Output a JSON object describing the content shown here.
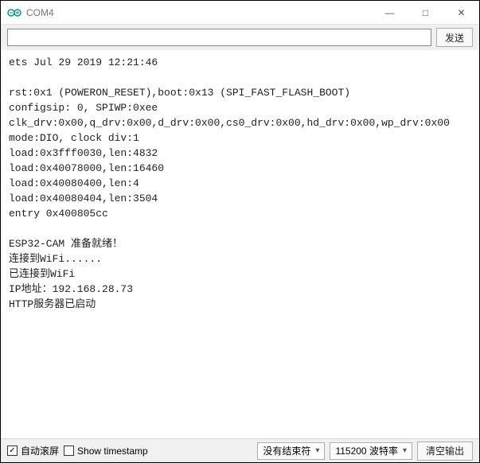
{
  "window": {
    "title": "COM4"
  },
  "toolbar": {
    "input_value": "",
    "input_placeholder": "",
    "send_label": "发送"
  },
  "console_text": "ets Jul 29 2019 12:21:46\n\nrst:0x1 (POWERON_RESET),boot:0x13 (SPI_FAST_FLASH_BOOT)\nconfigsip: 0, SPIWP:0xee\nclk_drv:0x00,q_drv:0x00,d_drv:0x00,cs0_drv:0x00,hd_drv:0x00,wp_drv:0x00\nmode:DIO, clock div:1\nload:0x3fff0030,len:4832\nload:0x40078000,len:16460\nload:0x40080400,len:4\nload:0x40080404,len:3504\nentry 0x400805cc\n\nESP32-CAM 准备就绪！\n连接到WiFi......\n已连接到WiFi\nIP地址：192.168.28.73\nHTTP服务器已启动",
  "statusbar": {
    "autoscroll": {
      "label": "自动滚屏",
      "checked": true
    },
    "timestamp": {
      "label": "Show timestamp",
      "checked": false
    },
    "line_ending": {
      "selected": "没有结束符"
    },
    "baud": {
      "selected": "115200 波特率"
    },
    "clear_label": "清空输出"
  },
  "icons": {
    "minimize": "—",
    "maximize": "□",
    "close": "✕",
    "check": "✓",
    "dropdown": "▾"
  },
  "colors": {
    "arduino_teal": "#00979C"
  }
}
